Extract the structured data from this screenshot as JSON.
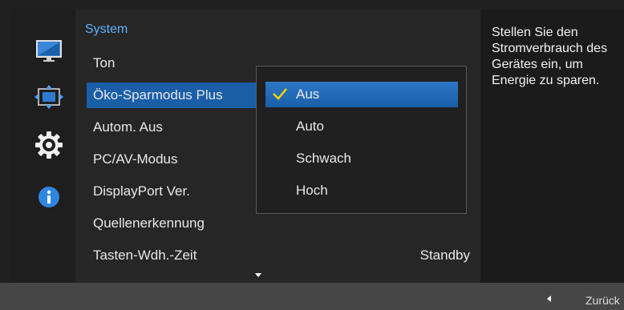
{
  "nav": {
    "icons": [
      "monitor-icon",
      "position-arrows-icon",
      "settings-gear-icon",
      "info-icon"
    ],
    "accent_color": "#1a5ea8"
  },
  "menu": {
    "title": "System",
    "items": [
      {
        "label": "Ton"
      },
      {
        "label": "Öko-Sparmodus Plus"
      },
      {
        "label": "Autom. Aus"
      },
      {
        "label": "PC/AV-Modus"
      },
      {
        "label": "DisplayPort Ver."
      },
      {
        "label": "Quellenerkennung"
      },
      {
        "label": "Tasten-Wdh.-Zeit",
        "value": "Standby"
      }
    ]
  },
  "dropdown": {
    "options": [
      "Aus",
      "Auto",
      "Schwach",
      "Hoch"
    ],
    "selected": "Aus"
  },
  "help": {
    "text": "Stellen Sie den Stromverbrauch des Gerätes ein, um Energie zu sparen."
  },
  "footer": {
    "back_label": "Zurück"
  }
}
